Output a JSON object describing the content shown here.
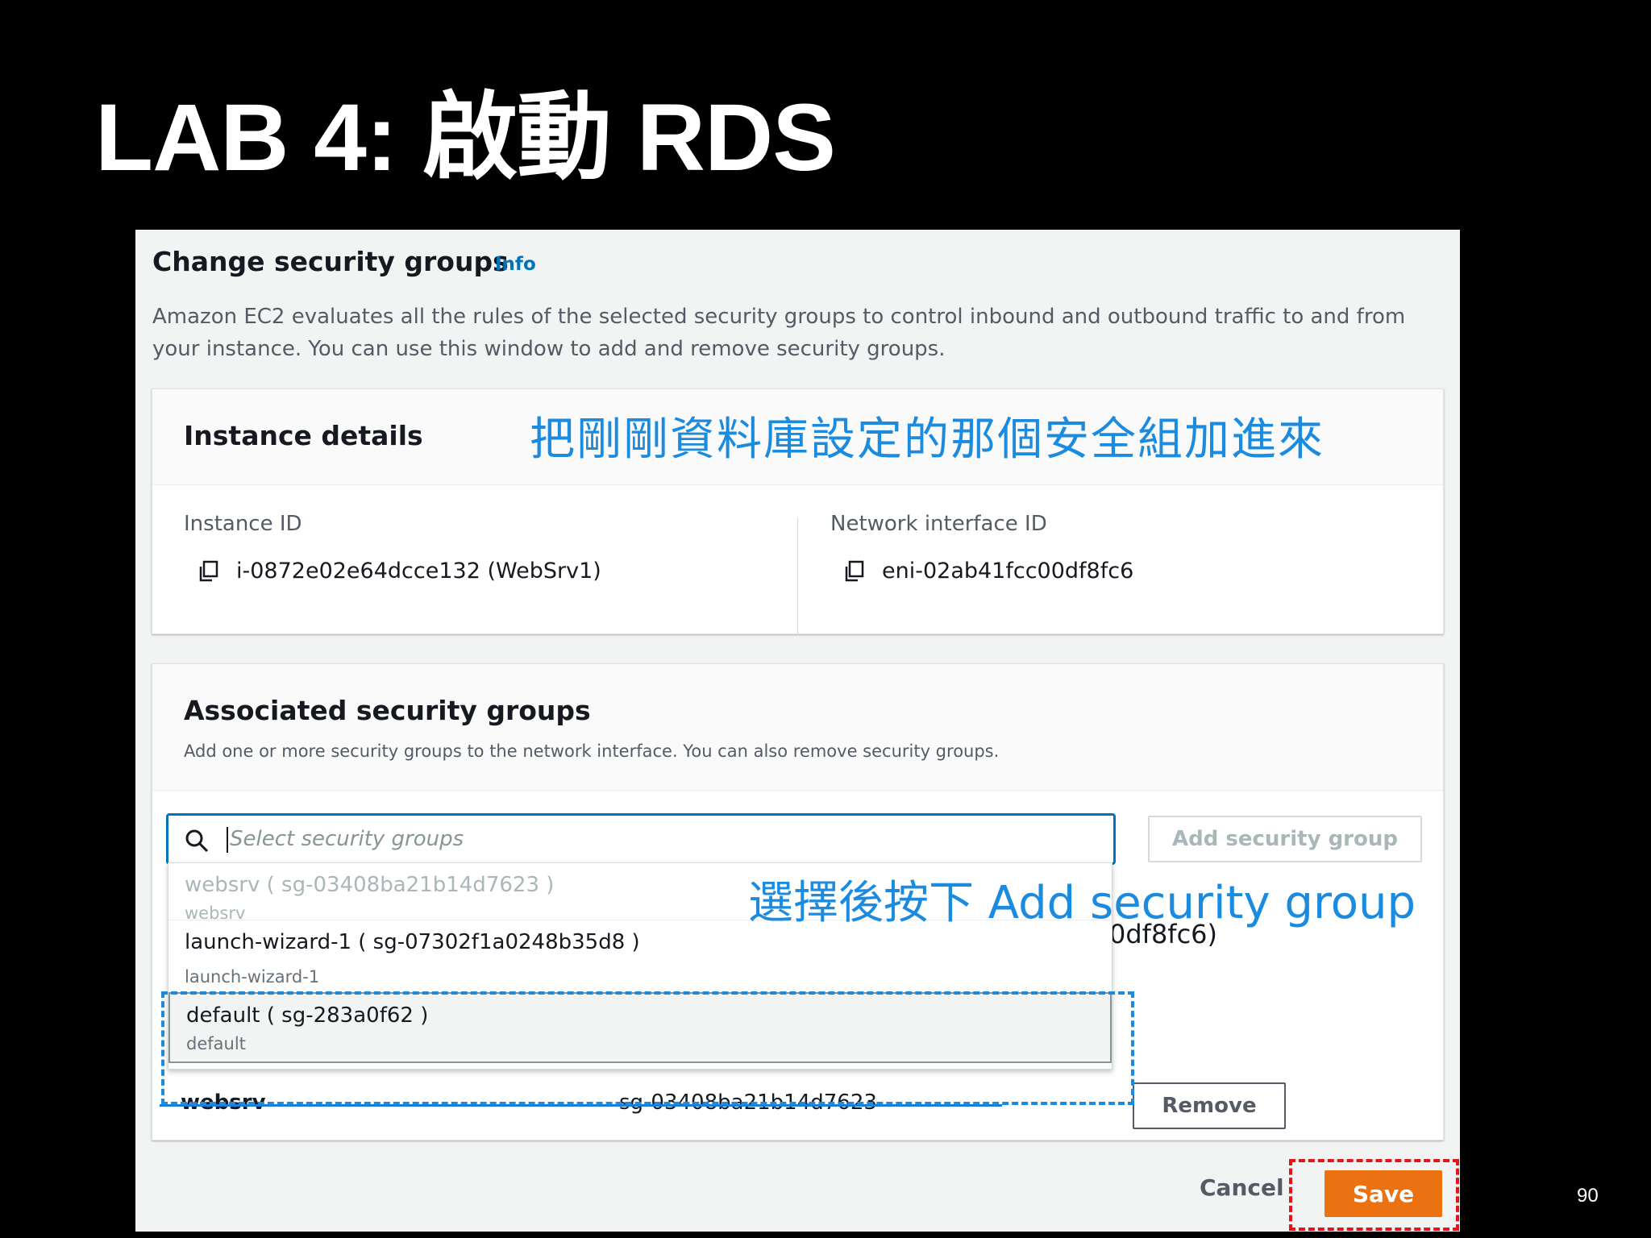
{
  "slide": {
    "title": "LAB 4: 啟動 RDS",
    "page_number": "90"
  },
  "panel": {
    "title": "Change security groups",
    "info_link": "Info",
    "description": "Amazon EC2 evaluates all the rules of the selected security groups to control inbound and outbound traffic to and from your instance. You can use this window to add and remove security groups."
  },
  "instance_details": {
    "title": "Instance details",
    "instance_id_label": "Instance ID",
    "instance_id_value": "i-0872e02e64dcce132 (WebSrv1)",
    "network_interface_label": "Network interface ID",
    "network_interface_value": "eni-02ab41fcc00df8fc6"
  },
  "associated": {
    "title": "Associated security groups",
    "description": "Add one or more security groups to the network interface. You can also remove security groups.",
    "search_placeholder": "Select security groups",
    "add_button": "Add security group",
    "eni_partial": "0df8fc6)",
    "remove_button": "Remove",
    "row_name": "websrv",
    "row_id": "sg-03408ba21b14d7623"
  },
  "dropdown_options": [
    {
      "name": "websrv ( sg-03408ba21b14d7623 )",
      "sub": "websrv",
      "state": "disabled"
    },
    {
      "name": "launch-wizard-1 ( sg-07302f1a0248b35d8 )",
      "sub": "launch-wizard-1",
      "state": "normal"
    },
    {
      "name": "default ( sg-283a0f62 )",
      "sub": "default",
      "state": "selected"
    }
  ],
  "annotations": {
    "instruction_top": "把剛剛資料庫設定的那個安全組加進來",
    "instruction_select": "選擇後按下 Add security group"
  },
  "footer": {
    "cancel": "Cancel",
    "save": "Save"
  },
  "colors": {
    "accent_blue": "#0073bb",
    "annotation_blue": "#1b8be0",
    "save_orange": "#ec7211",
    "highlight_red": "#e3141a"
  }
}
